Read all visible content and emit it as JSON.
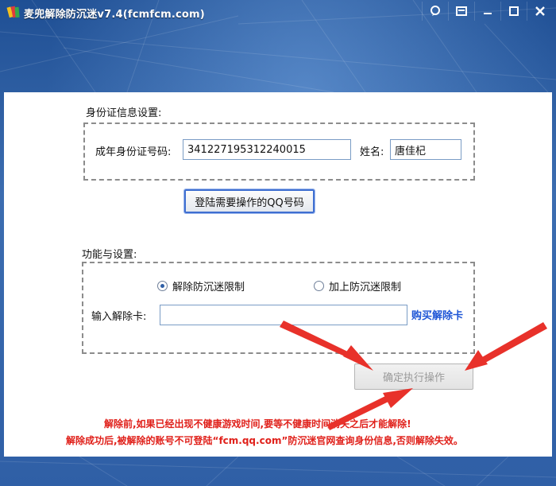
{
  "window": {
    "title": "麦兜解除防沉迷v7.4(fcmfcm.com)",
    "controls": [
      "feedback-icon",
      "skin-icon",
      "minimize-icon",
      "maximize-icon",
      "close-icon"
    ]
  },
  "identity": {
    "section_label": "身份证信息设置:",
    "id_label": "成年身份证号码:",
    "id_value": "341227195312240015",
    "name_label": "姓名:",
    "name_value": "唐佳杞",
    "login_button": "登陆需要操作的QQ号码"
  },
  "function": {
    "section_label": "功能与设置:",
    "options": [
      {
        "label": "解除防沉迷限制",
        "selected": true
      },
      {
        "label": "加上防沉迷限制",
        "selected": false
      }
    ],
    "card_label": "输入解除卡:",
    "card_value": "",
    "buy_link": "购买解除卡",
    "execute_button": "确定执行操作"
  },
  "notices": [
    "解除前,如果已经出现不健康游戏时间,要等不健康时间消失之后才能解除!",
    "解除成功后,被解除的账号不可登陆“fcm.qq.com”防沉迷官网查询身份信息,否则解除失效。"
  ],
  "colors": {
    "frame": "#2f5fa6",
    "notice_text": "#e0201a",
    "link": "#1f56d6",
    "arrow": "#e8312a"
  }
}
